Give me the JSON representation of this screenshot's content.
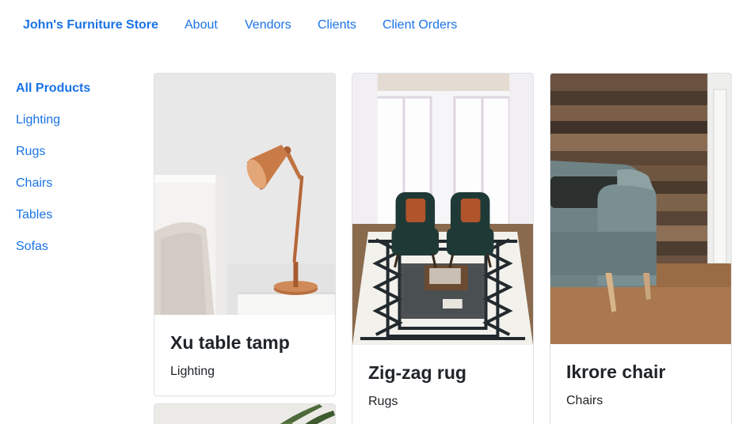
{
  "nav": {
    "brand": "John's Furniture Store",
    "links": [
      "About",
      "Vendors",
      "Clients",
      "Client Orders"
    ]
  },
  "sidebar": {
    "items": [
      {
        "label": "All Products",
        "active": true
      },
      {
        "label": "Lighting",
        "active": false
      },
      {
        "label": "Rugs",
        "active": false
      },
      {
        "label": "Chairs",
        "active": false
      },
      {
        "label": "Tables",
        "active": false
      },
      {
        "label": "Sofas",
        "active": false
      }
    ]
  },
  "products": [
    {
      "name": "Xu table tamp",
      "category": "Lighting"
    },
    {
      "name": "Zig-zag rug",
      "category": "Rugs"
    },
    {
      "name": "Ikrore chair",
      "category": "Chairs"
    }
  ],
  "colors": {
    "link": "#1a73e8",
    "text": "#212529",
    "card_border": "#dfe1e5"
  }
}
